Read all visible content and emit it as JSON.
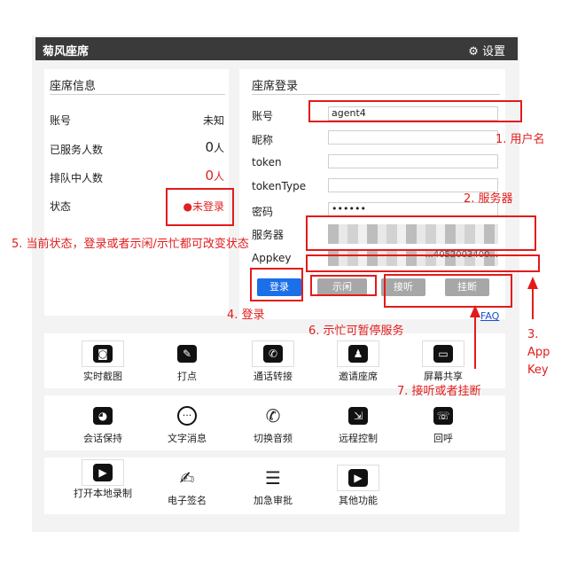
{
  "window": {
    "title": "菊风座席",
    "settings_label": "设置"
  },
  "info_panel": {
    "title": "座席信息",
    "rows": [
      {
        "label": "账号",
        "value": "未知"
      },
      {
        "label": "已服务人数",
        "value": "0",
        "unit": "人"
      },
      {
        "label": "排队中人数",
        "value": "0",
        "unit": "人"
      },
      {
        "label": "状态",
        "value": "●未登录"
      }
    ]
  },
  "login_panel": {
    "title": "座席登录",
    "fields": [
      {
        "label": "账号",
        "value": "agent4"
      },
      {
        "label": "昵称",
        "value": ""
      },
      {
        "label": "token",
        "value": ""
      },
      {
        "label": "tokenType",
        "value": ""
      },
      {
        "label": "密码",
        "value": "••••••"
      },
      {
        "label": "服务器",
        "value": ""
      },
      {
        "label": "Appkey",
        "value": "...4052003400..."
      }
    ],
    "buttons": {
      "login": "登录",
      "idle": "示闲",
      "answer": "接听",
      "hangup": "挂断"
    },
    "faq": "FAQ"
  },
  "tools": [
    [
      {
        "label": "实时截图",
        "icon": "camera-icon"
      },
      {
        "label": "打点",
        "icon": "mark-icon"
      },
      {
        "label": "通话转接",
        "icon": "call-transfer-icon"
      },
      {
        "label": "邀请座席",
        "icon": "invite-agent-icon"
      },
      {
        "label": "屏幕共享",
        "icon": "screen-share-icon"
      }
    ],
    [
      {
        "label": "会话保持",
        "icon": "session-hold-icon"
      },
      {
        "label": "文字消息",
        "icon": "text-message-icon"
      },
      {
        "label": "切换音频",
        "icon": "switch-audio-icon"
      },
      {
        "label": "远程控制",
        "icon": "remote-control-icon"
      },
      {
        "label": "回呼",
        "icon": "callback-icon"
      }
    ],
    [
      {
        "label": "打开本地录制",
        "icon": "local-record-icon"
      },
      {
        "label": "电子签名",
        "icon": "e-signature-icon"
      },
      {
        "label": "加急审批",
        "icon": "urgent-approval-icon"
      },
      {
        "label": "其他功能",
        "icon": "other-functions-icon"
      }
    ]
  ],
  "annotations": {
    "a1": "1. 用户名",
    "a2": "2. 服务器",
    "a3": "3.\nApp\nKey",
    "a4": "4. 登录",
    "a5": "5. 当前状态，登录或者示闲/示忙都可改变状态",
    "a6": "6. 示忙可暂停服务",
    "a7": "7. 接听或者挂断"
  },
  "colors": {
    "annotation_red": "#e31b1b",
    "login_blue": "#1b6fe8",
    "title_bar": "#3a3a3a"
  }
}
